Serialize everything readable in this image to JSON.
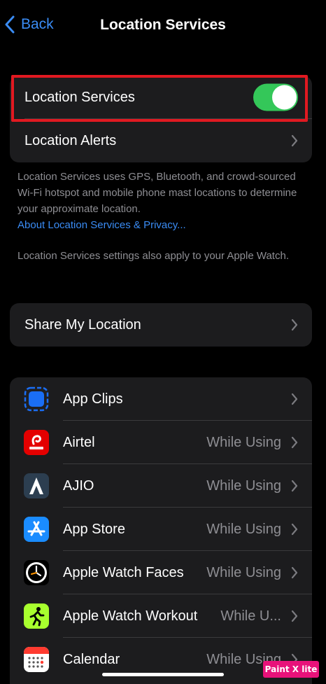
{
  "nav": {
    "back_label": "Back",
    "title": "Location Services"
  },
  "top_group": {
    "location_services_label": "Location Services",
    "location_services_on": true,
    "location_alerts_label": "Location Alerts"
  },
  "description": {
    "paragraph1": "Location Services uses GPS, Bluetooth, and crowd-sourced Wi-Fi hotspot and mobile phone mast locations to determine your approximate location.",
    "link": "About Location Services & Privacy...",
    "paragraph2": "Location Services settings also apply to your Apple Watch."
  },
  "share_group": {
    "share_label": "Share My Location"
  },
  "apps": [
    {
      "name": "App Clips",
      "value": "",
      "icon": "app-clips-icon"
    },
    {
      "name": "Airtel",
      "value": "While Using",
      "icon": "airtel-icon"
    },
    {
      "name": "AJIO",
      "value": "While Using",
      "icon": "ajio-icon"
    },
    {
      "name": "App Store",
      "value": "While Using",
      "icon": "app-store-icon"
    },
    {
      "name": "Apple Watch Faces",
      "value": "While Using",
      "icon": "watch-faces-icon"
    },
    {
      "name": "Apple Watch Workout",
      "value": "While U...",
      "icon": "workout-icon"
    },
    {
      "name": "Calendar",
      "value": "While Using",
      "icon": "calendar-icon"
    }
  ],
  "watermark": "Paint X lite",
  "colors": {
    "accent": "#3a8cf5",
    "toggle_on": "#34c759",
    "highlight": "#e11921",
    "cell_bg": "#1c1c1e"
  }
}
